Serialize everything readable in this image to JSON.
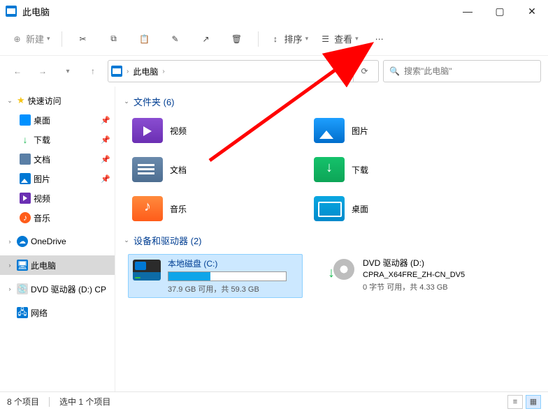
{
  "window": {
    "title": "此电脑"
  },
  "toolbar": {
    "new_label": "新建",
    "sort_label": "排序",
    "view_label": "查看"
  },
  "nav": {
    "breadcrumb": "此电脑",
    "breadcrumb_sep": "›",
    "search_placeholder": "搜索\"此电脑\""
  },
  "sidebar": {
    "quick": "快速访问",
    "desktop": "桌面",
    "downloads": "下载",
    "documents": "文档",
    "pictures": "图片",
    "videos": "视频",
    "music": "音乐",
    "onedrive": "OneDrive",
    "thispc": "此电脑",
    "dvd": "DVD 驱动器 (D:) CP",
    "network": "网络"
  },
  "sections": {
    "folders_label": "文件夹 (6)",
    "drives_label": "设备和驱动器 (2)"
  },
  "folders": {
    "videos": "视频",
    "pictures": "图片",
    "documents": "文档",
    "downloads": "下载",
    "music": "音乐",
    "desktop": "桌面"
  },
  "drives": {
    "c_name": "本地磁盘 (C:)",
    "c_stat": "37.9 GB 可用，共 59.3 GB",
    "d_name": "DVD 驱动器 (D:)",
    "d_sub": "CPRA_X64FRE_ZH-CN_DV5",
    "d_stat": "0 字节 可用，共 4.33 GB"
  },
  "status": {
    "items": "8 个项目",
    "selected": "选中 1 个项目"
  }
}
